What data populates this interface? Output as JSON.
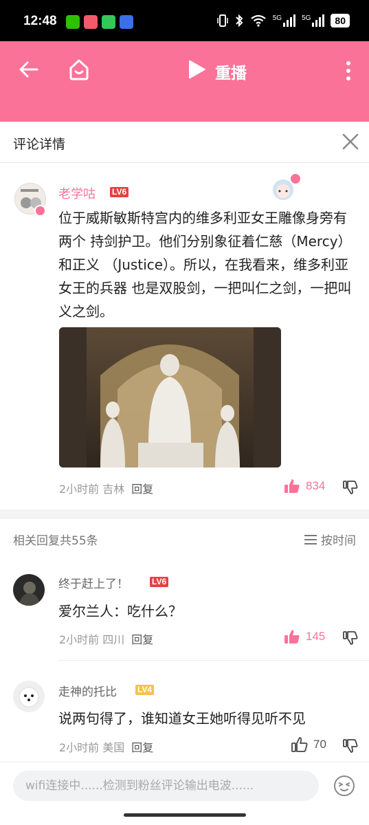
{
  "status": {
    "time": "12:48",
    "battery": "80",
    "network1": "5G",
    "network2": "5G"
  },
  "topbar": {
    "replay_label": "重播"
  },
  "page": {
    "title": "评论详情"
  },
  "main_comment": {
    "username": "老学咕",
    "level": "LV6",
    "text": "位于威斯敏斯特宫内的维多利亚女王雕像身旁有两个 持剑护卫。他们分别象征着仁慈（Mercy）和正义 （Justice）。所以，在我看来，维多利亚女王的兵器 也是双股剑，一把叫仁之剑，一把叫义之剑。",
    "time_location": "2小时前 吉林",
    "reply_label": "回复",
    "likes": "834"
  },
  "list_header": {
    "count": "相关回复共55条",
    "sort_label": "按时间"
  },
  "replies": [
    {
      "username": "终于赶上了！",
      "level": "LV6",
      "text": "爱尔兰人：吃什么？",
      "time_location": "2小时前 四川",
      "reply_label": "回复",
      "likes": "145",
      "liked": true
    },
    {
      "username": "走神的托比",
      "level": "LV4",
      "text": "说两句得了，谁知道女王她听得见听不见",
      "time_location": "2小时前 美国",
      "reply_label": "回复",
      "likes": "70",
      "liked": false
    }
  ],
  "bottom": {
    "input_placeholder": "wifi连接中......检测到粉丝评论输出电波......"
  },
  "colors": {
    "brand": "#fb7299",
    "lv6": "#e34342",
    "lv4": "#f3c24f"
  }
}
